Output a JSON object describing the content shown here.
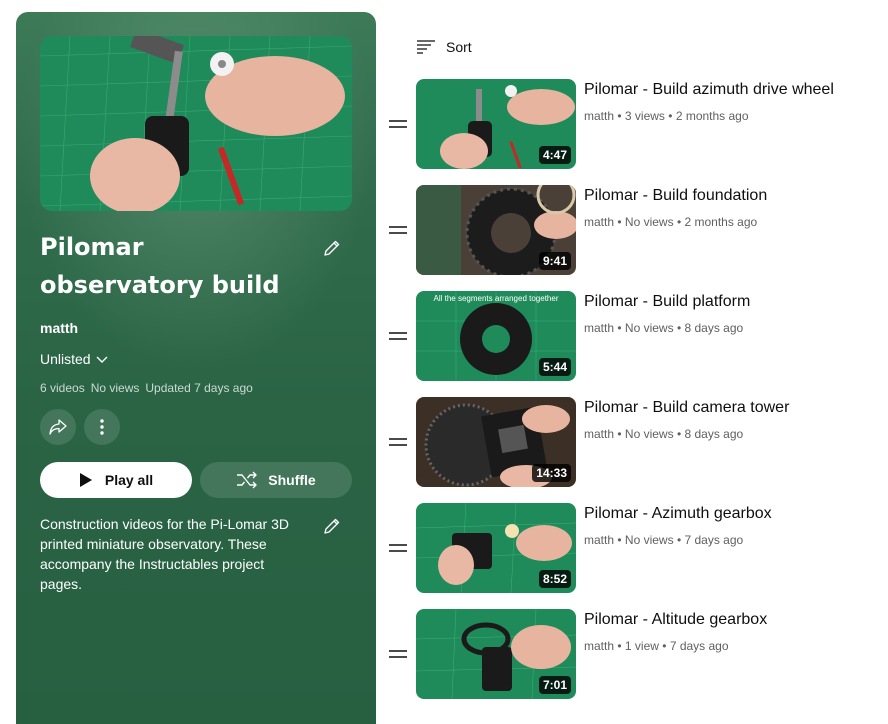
{
  "playlist": {
    "title": "Pilomar observatory build",
    "owner": "matth",
    "privacy": "Unlisted",
    "stats": {
      "videos": "6 videos",
      "views": "No views",
      "updated": "Updated 7 days ago"
    },
    "play_all_label": "Play all",
    "shuffle_label": "Shuffle",
    "description": "Construction videos for the Pi-Lomar 3D printed miniature observatory. These accompany the Instructables project pages."
  },
  "sort_label": "Sort",
  "meta_separator": "•",
  "videos": [
    {
      "title": "Pilomar - Build azimuth drive wheel",
      "channel": "matth",
      "views": "3 views",
      "age": "2 months ago",
      "duration": "4:47"
    },
    {
      "title": "Pilomar - Build foundation",
      "channel": "matth",
      "views": "No views",
      "age": "2 months ago",
      "duration": "9:41"
    },
    {
      "title": "Pilomar - Build platform",
      "channel": "matth",
      "views": "No views",
      "age": "8 days ago",
      "duration": "5:44",
      "thumb_caption": "All the segments arranged together"
    },
    {
      "title": "Pilomar - Build camera tower",
      "channel": "matth",
      "views": "No views",
      "age": "8 days ago",
      "duration": "14:33"
    },
    {
      "title": "Pilomar - Azimuth gearbox",
      "channel": "matth",
      "views": "No views",
      "age": "7 days ago",
      "duration": "8:52"
    },
    {
      "title": "Pilomar - Altitude gearbox",
      "channel": "matth",
      "views": "1 view",
      "age": "7 days ago",
      "duration": "7:01"
    }
  ],
  "colors": {
    "panel": "#2f6b4b",
    "cutting_mat": "#1f8a5a",
    "text_secondary": "#606060"
  }
}
